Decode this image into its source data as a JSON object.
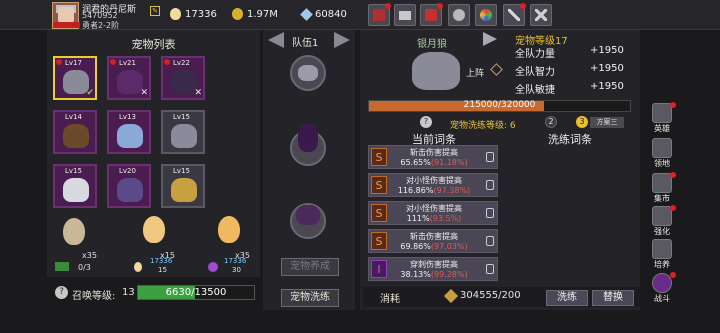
{
  "player": {
    "name": "润君的丹尼斯",
    "id": "5470952",
    "rank": "勇者2-2阶"
  },
  "resources": {
    "eggs": "17336",
    "gold": "1.97M",
    "gems": "60840"
  },
  "pet_list": {
    "title": "宠物列表",
    "slots": [
      {
        "lv": "Lv17"
      },
      {
        "lv": "Lv21"
      },
      {
        "lv": "Lv22"
      },
      {
        "lv": "Lv14"
      },
      {
        "lv": "Lv13"
      },
      {
        "lv": "Lv15"
      },
      {
        "lv": "Lv15"
      },
      {
        "lv": "Lv20"
      },
      {
        "lv": "Lv15"
      }
    ]
  },
  "eggs": [
    {
      "count": "x35",
      "progress": "0/3",
      "pct": 0
    },
    {
      "count": "x15",
      "progress_top": "17336",
      "progress_bottom": "15",
      "pct": 100
    },
    {
      "count": "x35",
      "progress_top": "17336",
      "progress_bottom": "30",
      "pct": 100
    }
  ],
  "summon": {
    "label": "召唤等级:",
    "level": "13",
    "value": "6630/13500",
    "fraction": 0.491
  },
  "team": {
    "label": "队伍1",
    "disabled_btn": "宠物养成",
    "wash_btn": "宠物洗练"
  },
  "detail": {
    "pet_name": "银月狼",
    "pet_level": "宠物等级17",
    "deploy": "上阵",
    "stats": [
      {
        "name": "全队力量",
        "value": "+1950"
      },
      {
        "name": "全队智力",
        "value": "+1950"
      },
      {
        "name": "全队敏捷",
        "value": "+1950"
      }
    ],
    "exp": "215000/320000",
    "exp_fraction": 0.672,
    "wash_level_label": "宠物洗练等级: 6",
    "plans": [
      "2",
      "3",
      "方案三"
    ],
    "current_affix_title": "当前词条",
    "wash_affix_title": "洗练词条",
    "affixes": [
      {
        "name": "斩击伤害提高",
        "value": "65.65%",
        "range": "(91.18%)"
      },
      {
        "name": "对小怪伤害提高",
        "value": "116.86%",
        "range": "(97.38%)"
      },
      {
        "name": "对小怪伤害提高",
        "value": "111%",
        "range": "(93.5%)"
      },
      {
        "name": "斩击伤害提高",
        "value": "69.86%",
        "range": "(97.03%)"
      },
      {
        "name": "穿刺伤害提高",
        "value": "38.13%",
        "range": "(99.28%)"
      }
    ],
    "cost_label": "消耗",
    "cost_value": "304555/200",
    "wash_btn": "洗练",
    "replace_btn": "替换"
  },
  "side_menu": [
    "英雄",
    "领地",
    "集市",
    "强化",
    "培养",
    "战斗"
  ]
}
